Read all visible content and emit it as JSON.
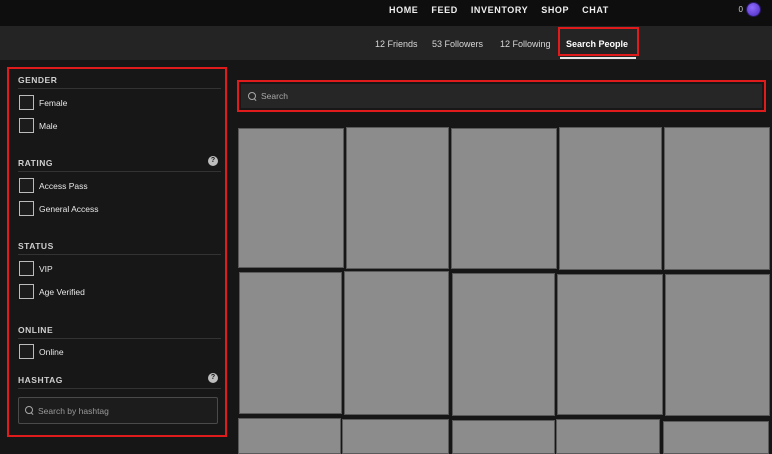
{
  "topnav": {
    "items": [
      {
        "label": "HOME"
      },
      {
        "label": "FEED"
      },
      {
        "label": "INVENTORY"
      },
      {
        "label": "SHOP"
      },
      {
        "label": "CHAT"
      }
    ],
    "wallet": {
      "count": "0",
      "icon": "coin-icon"
    }
  },
  "subnav": {
    "tabs": [
      {
        "label": "12 Friends",
        "active": false
      },
      {
        "label": "53 Followers",
        "active": false
      },
      {
        "label": "12 Following",
        "active": false
      },
      {
        "label": "Search People",
        "active": true
      }
    ]
  },
  "sidebar": {
    "gender": {
      "title": "GENDER",
      "options": [
        "Female",
        "Male"
      ]
    },
    "rating": {
      "title": "RATING",
      "help": "?",
      "options": [
        "Access Pass",
        "General Access"
      ]
    },
    "status": {
      "title": "STATUS",
      "options": [
        "VIP",
        "Age Verified"
      ]
    },
    "online": {
      "title": "ONLINE",
      "options": [
        "Online"
      ]
    },
    "hashtag": {
      "title": "HASHTAG",
      "help": "?",
      "placeholder": "Search by hashtag"
    }
  },
  "search": {
    "placeholder": "Search"
  },
  "results": {
    "count": 15
  }
}
